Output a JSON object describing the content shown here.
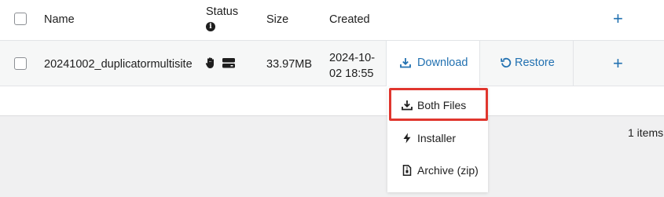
{
  "header": {
    "name": "Name",
    "status": "Status",
    "size": "Size",
    "created": "Created",
    "info_icon": "i"
  },
  "row": {
    "name": "20241002_duplicatormultisite",
    "size": "33.97MB",
    "created_line1": "2024-10-",
    "created_line2": "02 18:55",
    "download": "Download",
    "restore": "Restore"
  },
  "dropdown": {
    "items": [
      {
        "label": "Both Files",
        "icon": "download-icon"
      },
      {
        "label": "Installer",
        "icon": "bolt-icon"
      },
      {
        "label": "Archive (zip)",
        "icon": "zip-file-icon"
      }
    ]
  },
  "footer": {
    "items_count": "1 items"
  },
  "colors": {
    "accent": "#2271b1",
    "highlight": "#e0362e"
  }
}
